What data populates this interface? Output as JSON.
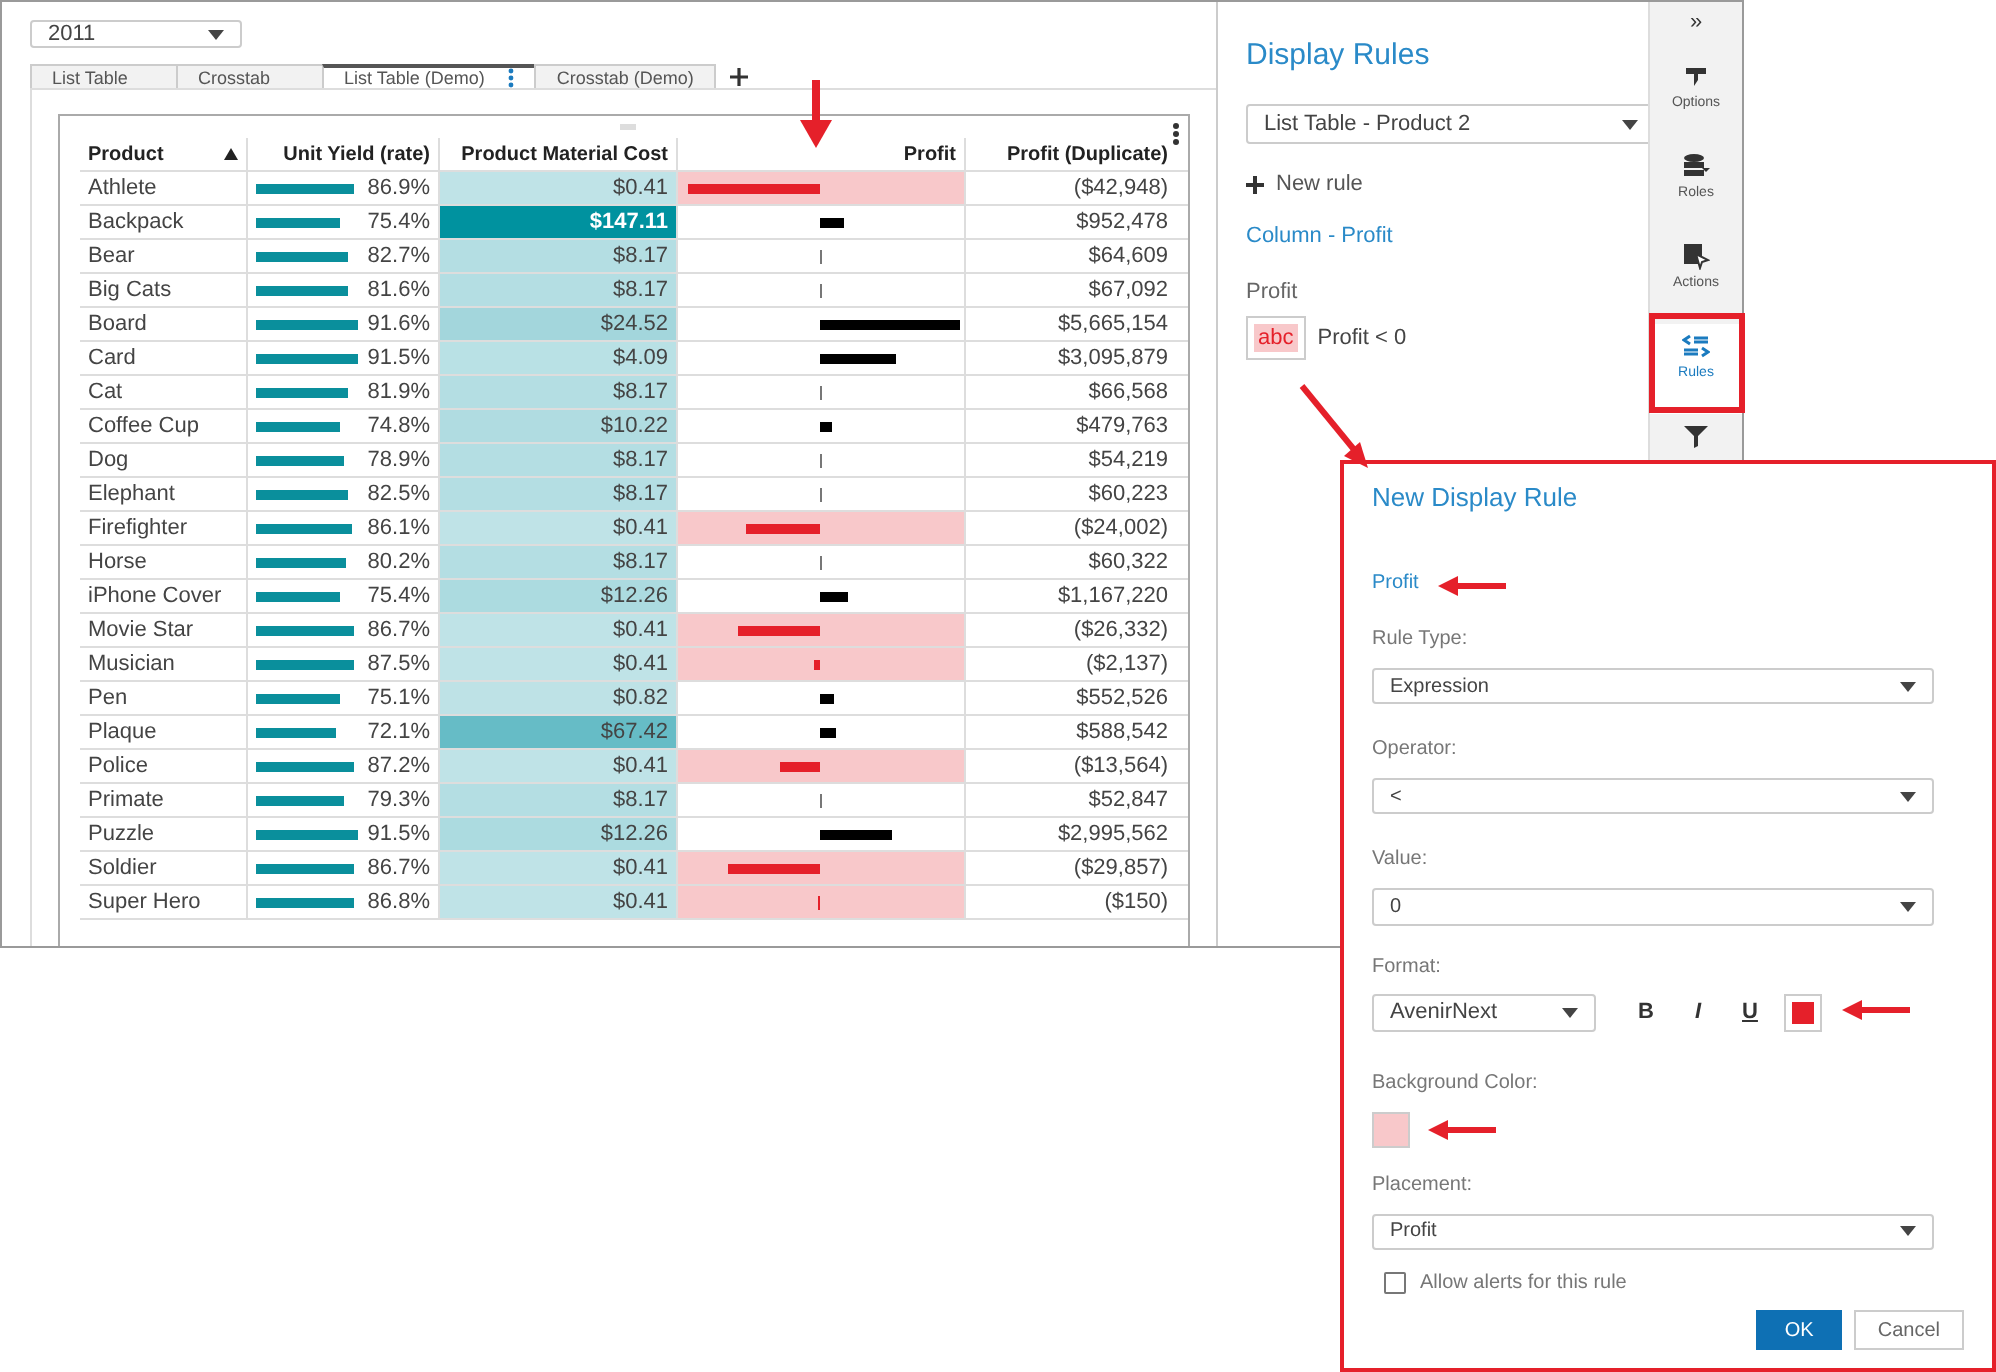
{
  "year_select": {
    "value": "2011"
  },
  "tabs": [
    {
      "label": "List Table",
      "selected": false,
      "has_menu": false
    },
    {
      "label": "Crosstab",
      "selected": false,
      "has_menu": false
    },
    {
      "label": "List Table (Demo)",
      "selected": true,
      "has_menu": true
    },
    {
      "label": "Crosstab (Demo)",
      "selected": false,
      "has_menu": false
    }
  ],
  "table": {
    "columns": [
      {
        "label": "Product",
        "sorted": true
      },
      {
        "label": "Unit Yield (rate)",
        "sorted": false
      },
      {
        "label": "Product Material Cost",
        "sorted": false
      },
      {
        "label": "Profit",
        "sorted": false
      },
      {
        "label": "Profit (Duplicate)",
        "sorted": false
      }
    ],
    "rows": [
      {
        "product": "Athlete",
        "unit_yield": {
          "text": "86.9%",
          "level": 0.869
        },
        "cost": {
          "text": "$0.41",
          "color": "#bfe3e7"
        },
        "profit": {
          "level": 0.97,
          "negative": true
        },
        "profit_duplicate": "($42,948)"
      },
      {
        "product": "Backpack",
        "unit_yield": {
          "text": "75.4%",
          "level": 0.754
        },
        "cost": {
          "text": "$147.11",
          "color": "#00929f"
        },
        "profit": {
          "level": 0.17,
          "negative": false
        },
        "profit_duplicate": "$952,478"
      },
      {
        "product": "Bear",
        "unit_yield": {
          "text": "82.7%",
          "level": 0.827
        },
        "cost": {
          "text": "$8.17",
          "color": "#b4dee3"
        },
        "profit": {
          "level": 0.015,
          "negative": false
        },
        "profit_duplicate": "$64,609"
      },
      {
        "product": "Big Cats",
        "unit_yield": {
          "text": "81.6%",
          "level": 0.816
        },
        "cost": {
          "text": "$8.17",
          "color": "#b4dee3"
        },
        "profit": {
          "level": 0.015,
          "negative": false
        },
        "profit_duplicate": "$67,092"
      },
      {
        "product": "Board",
        "unit_yield": {
          "text": "91.6%",
          "level": 0.916
        },
        "cost": {
          "text": "$24.52",
          "color": "#a3d6dc"
        },
        "profit": {
          "level": 1.0,
          "negative": false
        },
        "profit_duplicate": "$5,665,154"
      },
      {
        "product": "Card",
        "unit_yield": {
          "text": "91.5%",
          "level": 0.915
        },
        "cost": {
          "text": "$4.09",
          "color": "#b9e1e5"
        },
        "profit": {
          "level": 0.54,
          "negative": false
        },
        "profit_duplicate": "$3,095,879"
      },
      {
        "product": "Cat",
        "unit_yield": {
          "text": "81.9%",
          "level": 0.819
        },
        "cost": {
          "text": "$8.17",
          "color": "#b4dee3"
        },
        "profit": {
          "level": 0.015,
          "negative": false
        },
        "profit_duplicate": "$66,568"
      },
      {
        "product": "Coffee Cup",
        "unit_yield": {
          "text": "74.8%",
          "level": 0.748
        },
        "cost": {
          "text": "$10.22",
          "color": "#b0dce1"
        },
        "profit": {
          "level": 0.08,
          "negative": false
        },
        "profit_duplicate": "$479,763"
      },
      {
        "product": "Dog",
        "unit_yield": {
          "text": "78.9%",
          "level": 0.789
        },
        "cost": {
          "text": "$8.17",
          "color": "#b4dee3"
        },
        "profit": {
          "level": 0.015,
          "negative": false
        },
        "profit_duplicate": "$54,219"
      },
      {
        "product": "Elephant",
        "unit_yield": {
          "text": "82.5%",
          "level": 0.825
        },
        "cost": {
          "text": "$8.17",
          "color": "#b4dee3"
        },
        "profit": {
          "level": 0.015,
          "negative": false
        },
        "profit_duplicate": "$60,223"
      },
      {
        "product": "Firefighter",
        "unit_yield": {
          "text": "86.1%",
          "level": 0.861
        },
        "cost": {
          "text": "$0.41",
          "color": "#bfe3e7"
        },
        "profit": {
          "level": 0.54,
          "negative": true
        },
        "profit_duplicate": "($24,002)"
      },
      {
        "product": "Horse",
        "unit_yield": {
          "text": "80.2%",
          "level": 0.802
        },
        "cost": {
          "text": "$8.17",
          "color": "#b4dee3"
        },
        "profit": {
          "level": 0.015,
          "negative": false
        },
        "profit_duplicate": "$60,322"
      },
      {
        "product": "iPhone Cover",
        "unit_yield": {
          "text": "75.4%",
          "level": 0.754
        },
        "cost": {
          "text": "$12.26",
          "color": "#acdbe0"
        },
        "profit": {
          "level": 0.2,
          "negative": false
        },
        "profit_duplicate": "$1,167,220"
      },
      {
        "product": "Movie Star",
        "unit_yield": {
          "text": "86.7%",
          "level": 0.867
        },
        "cost": {
          "text": "$0.41",
          "color": "#bfe3e7"
        },
        "profit": {
          "level": 0.6,
          "negative": true
        },
        "profit_duplicate": "($26,332)"
      },
      {
        "product": "Musician",
        "unit_yield": {
          "text": "87.5%",
          "level": 0.875
        },
        "cost": {
          "text": "$0.41",
          "color": "#bfe3e7"
        },
        "profit": {
          "level": 0.04,
          "negative": true
        },
        "profit_duplicate": "($2,137)"
      },
      {
        "product": "Pen",
        "unit_yield": {
          "text": "75.1%",
          "level": 0.751
        },
        "cost": {
          "text": "$0.82",
          "color": "#bee2e6"
        },
        "profit": {
          "level": 0.1,
          "negative": false
        },
        "profit_duplicate": "$552,526"
      },
      {
        "product": "Plaque",
        "unit_yield": {
          "text": "72.1%",
          "level": 0.721
        },
        "cost": {
          "text": "$67.42",
          "color": "#66bcc6"
        },
        "profit": {
          "level": 0.11,
          "negative": false
        },
        "profit_duplicate": "$588,542"
      },
      {
        "product": "Police",
        "unit_yield": {
          "text": "87.2%",
          "level": 0.872
        },
        "cost": {
          "text": "$0.41",
          "color": "#bfe3e7"
        },
        "profit": {
          "level": 0.3,
          "negative": true
        },
        "profit_duplicate": "($13,564)"
      },
      {
        "product": "Primate",
        "unit_yield": {
          "text": "79.3%",
          "level": 0.793
        },
        "cost": {
          "text": "$8.17",
          "color": "#b4dee3"
        },
        "profit": {
          "level": 0.015,
          "negative": false
        },
        "profit_duplicate": "$52,847"
      },
      {
        "product": "Puzzle",
        "unit_yield": {
          "text": "91.5%",
          "level": 0.915
        },
        "cost": {
          "text": "$12.26",
          "color": "#acdbe0"
        },
        "profit": {
          "level": 0.52,
          "negative": false
        },
        "profit_duplicate": "$2,995,562"
      },
      {
        "product": "Soldier",
        "unit_yield": {
          "text": "86.7%",
          "level": 0.867
        },
        "cost": {
          "text": "$0.41",
          "color": "#bfe3e7"
        },
        "profit": {
          "level": 0.68,
          "negative": true
        },
        "profit_duplicate": "($29,857)"
      },
      {
        "product": "Super Hero",
        "unit_yield": {
          "text": "86.8%",
          "level": 0.868
        },
        "cost": {
          "text": "$0.41",
          "color": "#bfe3e7"
        },
        "profit": {
          "level": 0.015,
          "negative": true
        },
        "profit_duplicate": "($150)"
      }
    ]
  },
  "panel": {
    "title": "Display Rules",
    "object_select": "List Table - Product 2",
    "new_rule": "New rule",
    "column_link": "Column - Profit",
    "rules": [
      {
        "column": "Profit",
        "sample": "abc",
        "condition": "Profit < 0"
      }
    ]
  },
  "sidebar": {
    "collapse": "»",
    "items": [
      {
        "kind": "options",
        "label": "Options",
        "selected": false
      },
      {
        "kind": "roles",
        "label": "Roles",
        "selected": false
      },
      {
        "kind": "actions",
        "label": "Actions",
        "selected": false
      },
      {
        "kind": "rules",
        "label": "Rules",
        "selected": true
      },
      {
        "kind": "filters",
        "selected": false
      }
    ]
  },
  "dialog": {
    "title": "New Display Rule",
    "column": "Profit",
    "fields": [
      {
        "label": "Rule Type:",
        "value": "Expression"
      },
      {
        "label": "Operator:",
        "value": "<"
      },
      {
        "label": "Value:",
        "value": "0"
      }
    ],
    "format": {
      "label": "Format:",
      "font": "AvenirNext",
      "bold": "B",
      "italic": "I",
      "underline": "U",
      "color": "#e5202a"
    },
    "background": {
      "label": "Background Color:",
      "color": "#f8c8ca"
    },
    "placement": {
      "label": "Placement:",
      "value": "Profit"
    },
    "allow_alerts": {
      "label": "Allow alerts for this rule",
      "checked": false
    },
    "buttons": [
      {
        "label": "OK",
        "kind": "primary"
      },
      {
        "label": "Cancel",
        "kind": "secondary"
      }
    ]
  }
}
